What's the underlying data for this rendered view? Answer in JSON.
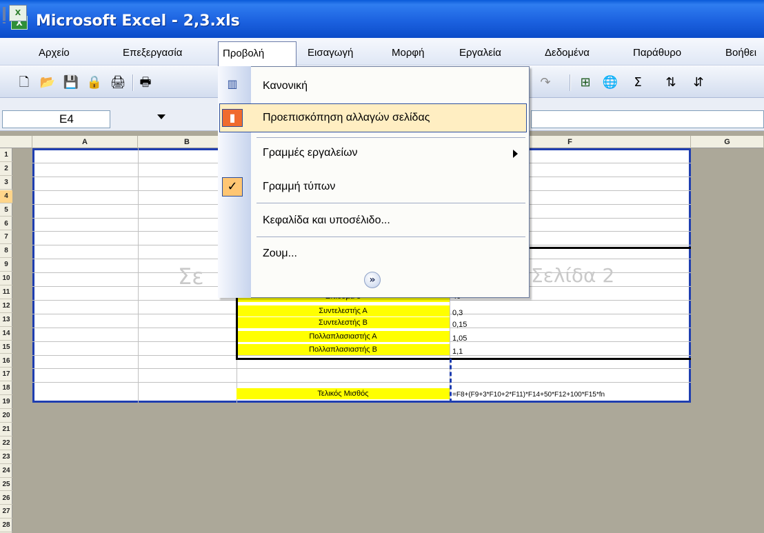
{
  "window": {
    "title": "Microsoft Excel - 2,3.xls",
    "logo_letter": "X"
  },
  "menubar": {
    "doc_icon": "excel-doc-icon",
    "items": [
      {
        "label": "Αρχείο"
      },
      {
        "label": "Επεξεργασία"
      },
      {
        "label": "Προβολή"
      },
      {
        "label": "Εισαγωγή"
      },
      {
        "label": "Μορφή"
      },
      {
        "label": "Εργαλεία"
      },
      {
        "label": "Δεδομένα"
      },
      {
        "label": "Παράθυρο"
      },
      {
        "label": "Βοήθει"
      }
    ],
    "active": "Προβολή"
  },
  "toolbar": {
    "icons": [
      "new-icon",
      "open-icon",
      "save-icon",
      "permission-icon",
      "print-icon",
      "print-preview-icon",
      "redo-icon",
      "insert-hyperlink-icon",
      "web-icon",
      "autosum-icon",
      "sort-ascending-icon",
      "sort-descending-icon"
    ],
    "sigma": "Σ"
  },
  "formula_bar": {
    "name_box": "E4"
  },
  "sheet": {
    "columns": [
      "A",
      "B",
      "F",
      "G"
    ],
    "rows": [
      "1",
      "2",
      "3",
      "4",
      "5",
      "6",
      "7",
      "8",
      "9",
      "10",
      "11",
      "12",
      "13",
      "14",
      "15",
      "16",
      "17",
      "18",
      "19",
      "20",
      "21",
      "22",
      "23",
      "24",
      "25",
      "26",
      "27",
      "28"
    ],
    "watermark_page1": "Σε",
    "watermark_page2": "Σελίδα 2",
    "cells": [
      {
        "label": "Επίδομα 3",
        "value": "40"
      },
      {
        "label": "Συντελεστής Α",
        "value": "0,3"
      },
      {
        "label": "Συντελεστής Β",
        "value": "0,15"
      },
      {
        "label": "Πολλαπλασιαστής Α",
        "value": "1,05"
      },
      {
        "label": "Πολλαπλασιαστής Β",
        "value": "1,1"
      }
    ],
    "final_label": "Τελικός Μισθός",
    "final_formula": "=F8+(F9+3*F10+2*F11)*F14+50*F12+100*F15*fn"
  },
  "view_menu": {
    "items": [
      {
        "label": "Κανονική",
        "icon": "normal-view-icon"
      },
      {
        "label": "Προεπισκόπηση αλλαγών σελίδας",
        "icon": "page-break-preview-icon",
        "highlighted": true
      },
      {
        "label": "Γραμμές εργαλείων",
        "submenu": true
      },
      {
        "label": "Γραμμή τύπων",
        "checked": true
      },
      {
        "label": "Κεφαλίδα και υποσέλιδο..."
      },
      {
        "label": "Ζουμ..."
      }
    ],
    "check_glyph": "✓",
    "expand_glyph": "»"
  },
  "colors": {
    "titlebar": "#1c62e0",
    "highlight": "#ffeec2",
    "yellow_cell": "#ffff00",
    "print_area_border": "#1f3eb0"
  }
}
